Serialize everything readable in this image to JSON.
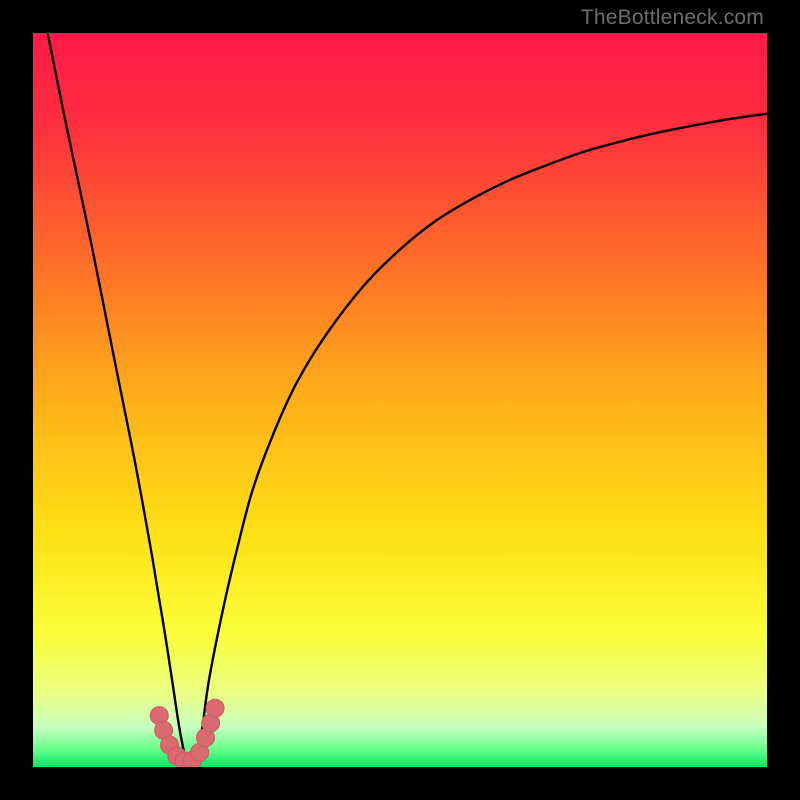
{
  "watermark": "TheBottleneck.com",
  "colors": {
    "gradient_stops": [
      {
        "offset": 0.0,
        "color": "#ff1a48"
      },
      {
        "offset": 0.12,
        "color": "#ff2d3f"
      },
      {
        "offset": 0.3,
        "color": "#ff6a2a"
      },
      {
        "offset": 0.5,
        "color": "#ffb019"
      },
      {
        "offset": 0.68,
        "color": "#ffe015"
      },
      {
        "offset": 0.82,
        "color": "#faff3a"
      },
      {
        "offset": 0.9,
        "color": "#e9ff84"
      },
      {
        "offset": 0.945,
        "color": "#c9ffc0"
      },
      {
        "offset": 0.975,
        "color": "#6cff8d"
      },
      {
        "offset": 1.0,
        "color": "#00e860"
      }
    ],
    "curve": "#000000",
    "marker_fill": "#d96a6f",
    "marker_stroke": "#c95a60"
  },
  "chart_data": {
    "type": "line",
    "title": "",
    "xlabel": "",
    "ylabel": "",
    "xlim": [
      0,
      100
    ],
    "ylim": [
      0,
      100
    ],
    "grid": false,
    "legend": false,
    "series": [
      {
        "name": "curve",
        "x": [
          0,
          2,
          4,
          6,
          8,
          10,
          12,
          14,
          16,
          17,
          18,
          19,
          20,
          21,
          22,
          23,
          24,
          26,
          28,
          30,
          33,
          36,
          40,
          45,
          50,
          55,
          60,
          65,
          70,
          75,
          80,
          85,
          90,
          95,
          100
        ],
        "y": [
          110,
          100,
          90,
          80.5,
          71,
          61,
          51,
          41,
          30,
          24,
          18,
          11.5,
          5,
          0.5,
          0.5,
          5,
          12,
          22,
          30.5,
          38,
          46,
          52.5,
          59,
          65.5,
          70.5,
          74.5,
          77.5,
          80,
          82,
          83.8,
          85.2,
          86.4,
          87.4,
          88.3,
          89
        ]
      }
    ],
    "markers": [
      {
        "x": 17.2,
        "y": 7.0
      },
      {
        "x": 17.8,
        "y": 5.0
      },
      {
        "x": 18.6,
        "y": 3.0
      },
      {
        "x": 19.6,
        "y": 1.5
      },
      {
        "x": 20.6,
        "y": 0.8
      },
      {
        "x": 21.7,
        "y": 0.9
      },
      {
        "x": 22.7,
        "y": 2.0
      },
      {
        "x": 23.5,
        "y": 4.0
      },
      {
        "x": 24.2,
        "y": 6.0
      },
      {
        "x": 24.8,
        "y": 8.0
      }
    ]
  }
}
